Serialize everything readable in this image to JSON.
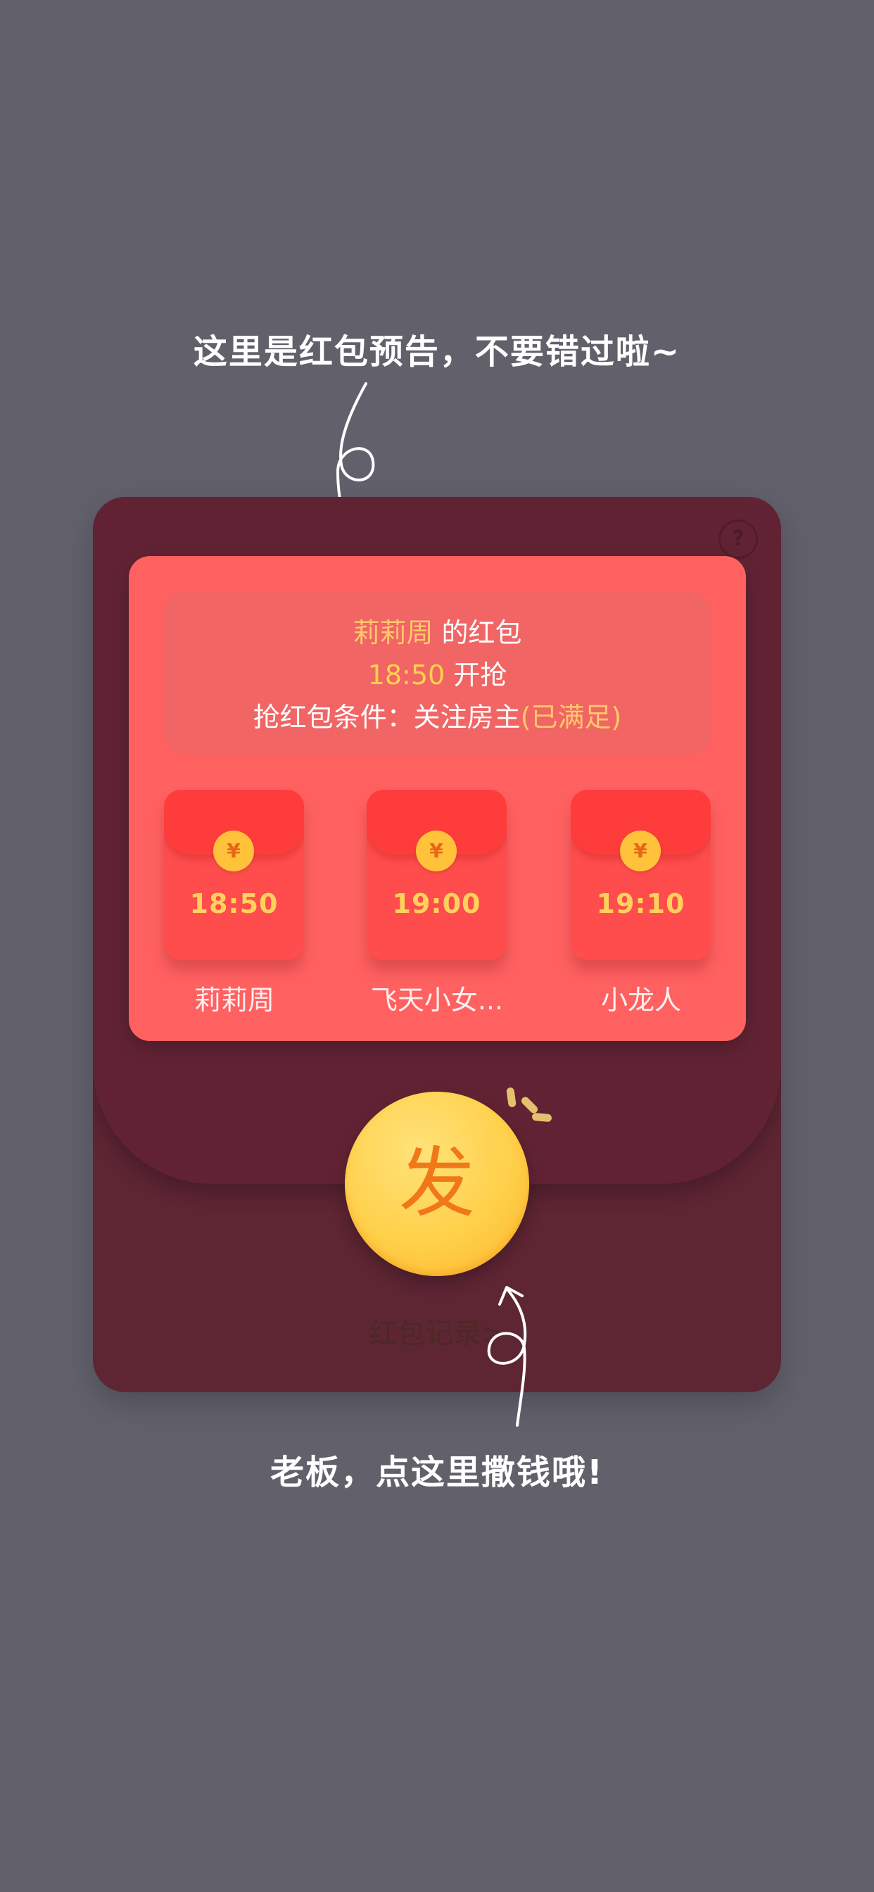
{
  "tips": {
    "top": "这里是红包预告，不要错过啦~",
    "bottom": "老板，点这里撒钱哦!"
  },
  "help_icon": "?",
  "preview": {
    "line1": {
      "sender": "莉莉周",
      "suffix": " 的红包"
    },
    "line2": {
      "time": "18:50",
      "suffix": " 开抢"
    },
    "line3": {
      "label": "抢红包条件：关注房主",
      "status": "(已满足)"
    }
  },
  "packets": [
    {
      "currency": "¥",
      "time": "18:50",
      "name": "莉莉周"
    },
    {
      "currency": "¥",
      "time": "19:00",
      "name": "飞天小女..."
    },
    {
      "currency": "¥",
      "time": "19:10",
      "name": "小龙人"
    }
  ],
  "send_button": {
    "label": "发"
  },
  "record_link": "红包记录>",
  "colors": {
    "background": "#61606b",
    "card": "#5e2533",
    "panel": "#ff6161",
    "gold": "#ffd14d",
    "send_button": "#ffd04a"
  },
  "icons": [
    "question-circle-icon",
    "yuan-coin-icon",
    "curly-arrow-icon",
    "sparkle-icon"
  ]
}
